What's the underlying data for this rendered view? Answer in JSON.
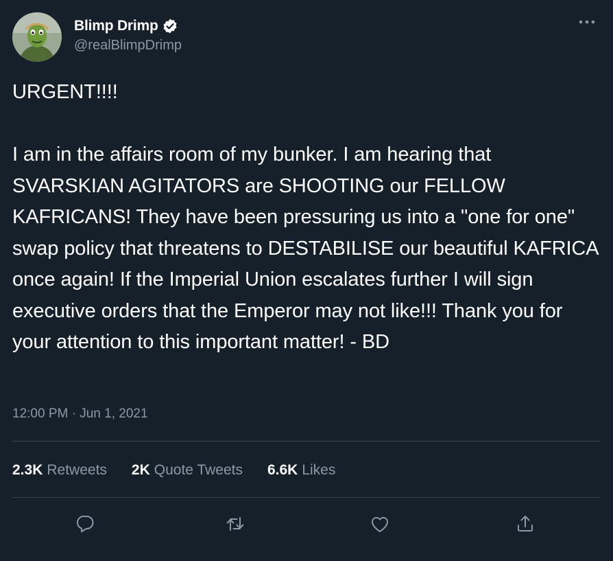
{
  "author": {
    "display_name": "Blimp Drimp",
    "handle": "@realBlimpDrimp",
    "verified": true,
    "avatar_icon": "avatar-image"
  },
  "menu_icon": "more-options-icon",
  "tweet": {
    "text": "URGENT!!!!\n\nI am in the affairs room of my bunker. I am hearing that SVARSKIAN AGITATORS are SHOOTING our FELLOW KAFRICANS! They have been pressuring us into a \"one for one\" swap policy that threatens to DESTABILISE our beautiful KAFRICA once again! If the Imperial Union escalates further I will sign executive orders that the Emperor may not like!!! Thank you for your attention to this important matter! - BD",
    "time": "12:00 PM",
    "separator": " · ",
    "date": "Jun 1, 2021"
  },
  "stats": {
    "retweets_count": "2.3K",
    "retweets_label": "Retweets",
    "quotes_count": "2K",
    "quotes_label": "Quote Tweets",
    "likes_count": "6.6K",
    "likes_label": "Likes"
  },
  "actions": [
    "reply-icon",
    "retweet-icon",
    "like-icon",
    "share-icon"
  ],
  "colors": {
    "background": "#15202b",
    "text_primary": "#ffffff",
    "text_secondary": "#8b98a5",
    "divider": "#38444d",
    "verified_badge": "#ffffff"
  }
}
